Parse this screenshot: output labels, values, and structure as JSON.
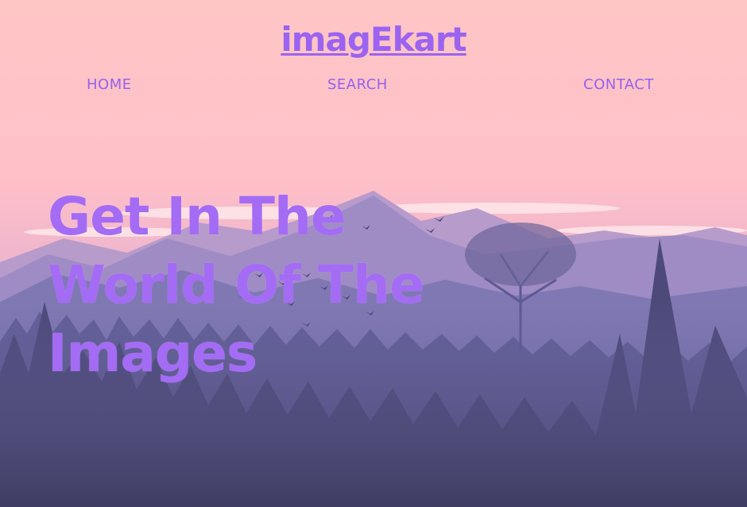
{
  "brand": {
    "name": "imagEkart"
  },
  "nav": {
    "items": [
      {
        "label": "HOME"
      },
      {
        "label": "SEARCH"
      },
      {
        "label": "CONTACT"
      }
    ]
  },
  "hero": {
    "headline_lines": [
      "Get In The",
      "World Of The",
      "Images"
    ]
  },
  "colors": {
    "accent": "#9b63f0",
    "sky_top": "#ffc7c7",
    "forest_dark": "#3b3a5a"
  }
}
